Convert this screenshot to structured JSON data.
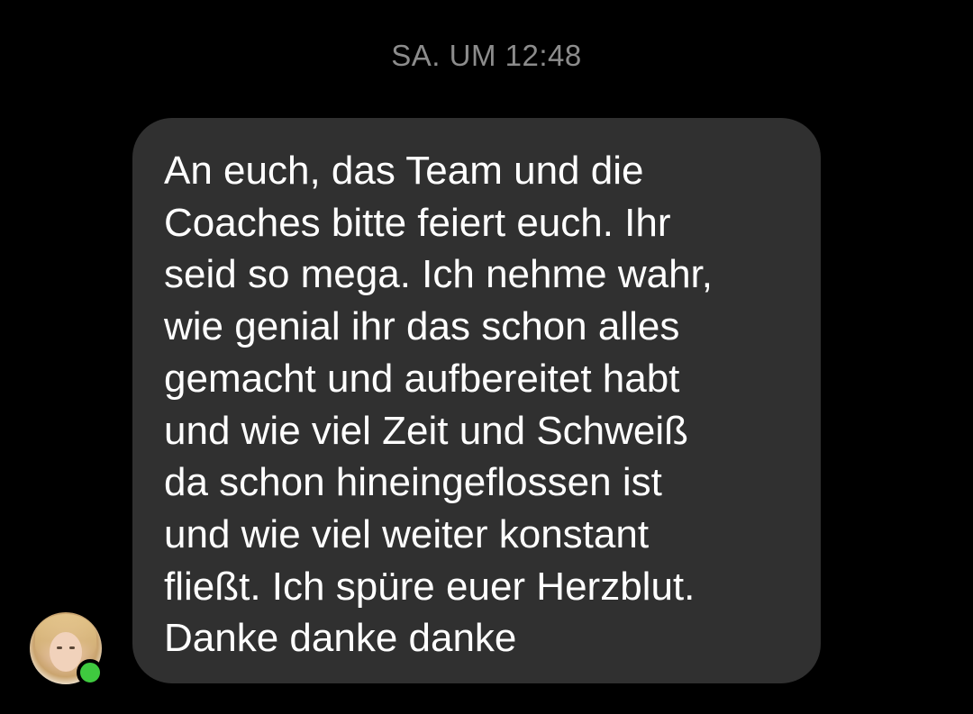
{
  "chat": {
    "timestamp": "SA. UM 12:48",
    "message": {
      "text": "An euch, das Team und die\nCoaches bitte feiert euch. Ihr\nseid so mega. Ich nehme wahr,\nwie genial ihr das schon alles\ngemacht und aufbereitet habt\nund wie viel Zeit und Schweiß\nda schon hineingeflossen ist\nund wie viel weiter konstant\nfließt. Ich spüre euer Herzblut.\nDanke danke danke",
      "bubble_color": "#303030",
      "text_color": "#ffffff"
    },
    "sender": {
      "avatar_icon": "user-avatar",
      "online": true,
      "online_color": "#3fca3f"
    }
  }
}
